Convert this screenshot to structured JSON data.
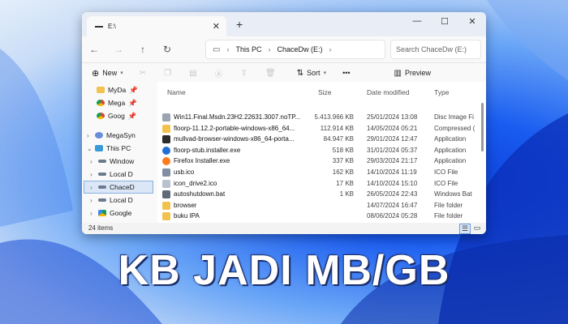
{
  "colors": {
    "accent": "#0a5ad8",
    "folder": "#f2c14e",
    "selection": "#dbe7f7"
  },
  "window": {
    "tab_title": "E:\\",
    "controls": {
      "minimize": "—",
      "maximize": "☐",
      "close": "✕"
    }
  },
  "nav": {
    "back": "←",
    "forward": "→",
    "up": "↑",
    "refresh": "↻",
    "breadcrumb": [
      "This PC",
      "ChaceDw (E:)"
    ],
    "search_placeholder": "Search ChaceDw (E:)"
  },
  "toolbar": {
    "new_label": "New",
    "sort_label": "Sort",
    "more_label": "•••",
    "preview_label": "Preview"
  },
  "sidebar": {
    "items": [
      {
        "label": "MyDa",
        "icon": "folder-icon",
        "pinned": true
      },
      {
        "label": "Mega",
        "icon": "chrome-icon",
        "pinned": true
      },
      {
        "label": "Goog",
        "icon": "chrome-icon",
        "pinned": true
      },
      {
        "label": "MegaSyn",
        "icon": "cloud-icon",
        "pinned": false
      },
      {
        "label": "This PC",
        "icon": "pc-icon",
        "pinned": false
      },
      {
        "label": "Window",
        "icon": "drive-icon",
        "pinned": false
      },
      {
        "label": "Local D",
        "icon": "drive-icon",
        "pinned": false
      },
      {
        "label": "ChaceD",
        "icon": "drive-icon",
        "pinned": false,
        "selected": true
      },
      {
        "label": "Local D",
        "icon": "drive-icon",
        "pinned": false
      },
      {
        "label": "Google",
        "icon": "gdrive-icon",
        "pinned": false
      }
    ]
  },
  "table": {
    "headers": {
      "name": "Name",
      "size": "Size",
      "date": "Date modified",
      "type": "Type"
    },
    "rows": [
      {
        "name": "Win11.Final.Msdn.23H2.22631.3007.noTP...",
        "size": "5.413.966 KB",
        "date": "25/01/2024 13:08",
        "type": "Disc Image Fi",
        "icon": "disc-icon"
      },
      {
        "name": "floorp-11.12.2-portable-windows-x86_64...",
        "size": "112.914 KB",
        "date": "14/05/2024 05:21",
        "type": "Compressed (",
        "icon": "zip-icon"
      },
      {
        "name": "mullvad-browser-windows-x86_64-porta...",
        "size": "84.947 KB",
        "date": "29/01/2024 12:47",
        "type": "Application",
        "icon": "app-icon"
      },
      {
        "name": "floorp-stub.installer.exe",
        "size": "518 KB",
        "date": "31/01/2024 05:37",
        "type": "Application",
        "icon": "floorp-icon"
      },
      {
        "name": "Firefox Installer.exe",
        "size": "337 KB",
        "date": "29/03/2024 21:17",
        "type": "Application",
        "icon": "firefox-icon"
      },
      {
        "name": "usb.ico",
        "size": "162 KB",
        "date": "14/10/2024 11:19",
        "type": "ICO File",
        "icon": "usb-icon"
      },
      {
        "name": "icon_drive2.ico",
        "size": "17 KB",
        "date": "14/10/2024 15:10",
        "type": "ICO File",
        "icon": "drive-file-icon"
      },
      {
        "name": "autoshutdown.bat",
        "size": "1 KB",
        "date": "26/05/2024 22:43",
        "type": "Windows Bat",
        "icon": "bat-icon"
      },
      {
        "name": "browser",
        "size": "",
        "date": "14/07/2024 16:47",
        "type": "File folder",
        "icon": "folder-icon"
      },
      {
        "name": "buku IPA",
        "size": "",
        "date": "08/06/2024 05:28",
        "type": "File folder",
        "icon": "folder-icon"
      }
    ]
  },
  "status": {
    "item_count": "24 items"
  },
  "overlay": {
    "title": "KB JADI MB/GB"
  }
}
